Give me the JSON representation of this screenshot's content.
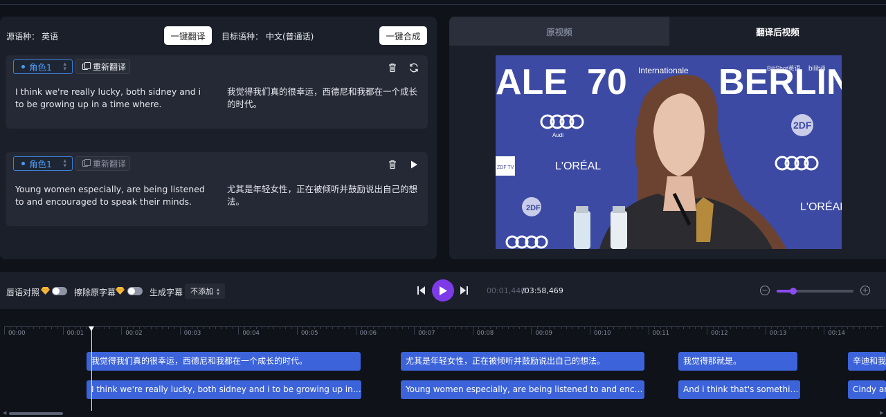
{
  "toolbar": {
    "source_label": "源语种：",
    "source_value": "英语",
    "translate_all": "一键翻译",
    "target_label": "目标语种：",
    "target_value": "中文(普通话)",
    "synthesize_all": "一键合成"
  },
  "segments": [
    {
      "role": "角色1",
      "retranslate": "重新翻译",
      "en": "I think we're really lucky, both sidney and i to be growing up in a time where.",
      "zh": "我觉得我们真的很幸运，西德尼和我都在一个成长的时代。"
    },
    {
      "role": "角色1",
      "retranslate": "重新翻译",
      "en": "Young women especially, are being listened to and encouraged to speak their minds.",
      "zh": "尤其是年轻女性，正在被倾听并鼓励说出自己的想法。"
    }
  ],
  "video": {
    "tab_original": "原视频",
    "tab_translated": "翻译后视频",
    "banner_70": "70",
    "banner_berlin": "BERLINA",
    "banner_ale": "ALE",
    "banner_intl": "Internationale",
    "watermark": "BiliShot英语",
    "watermark2": "bilibili",
    "sponsor_audi": "Audi",
    "sponsor_loreal": "L'ORÉAL",
    "sponsor_zdf": "2DF",
    "sponsor_tv": "ZDF TV"
  },
  "controls": {
    "lip_sync": "唇语对照",
    "erase_subs": "擦除原字幕",
    "gen_subs": "生成字幕",
    "gen_subs_value": "不添加",
    "time_current": "00:01,440",
    "time_total": "/03:58,469",
    "zoom_level": 0.22
  },
  "timeline": {
    "ticks": [
      "00:00",
      "00:01",
      "00:02",
      "00:03",
      "00:04",
      "00:05",
      "00:06",
      "00:07",
      "00:08",
      "00:09",
      "00:10",
      "00:11",
      "00:12",
      "00:13",
      "00:14"
    ],
    "zh_clips": [
      "我觉得我们真的很幸运，西德尼和我都在一个成长的时代。",
      "尤其是年轻女性，正在被倾听并鼓励说出自己的想法。",
      "我觉得那就是。",
      "辛迪和我"
    ],
    "en_clips": [
      "I think we're really lucky, both sidney and i to be growing up in a time ...",
      "Young women especially, are being listened to and encourag...",
      "And i think that's something...",
      "Cindy an"
    ]
  },
  "colors": {
    "accent": "#7d3be8",
    "clip": "#3c63d9",
    "role": "#4d9bf5"
  }
}
